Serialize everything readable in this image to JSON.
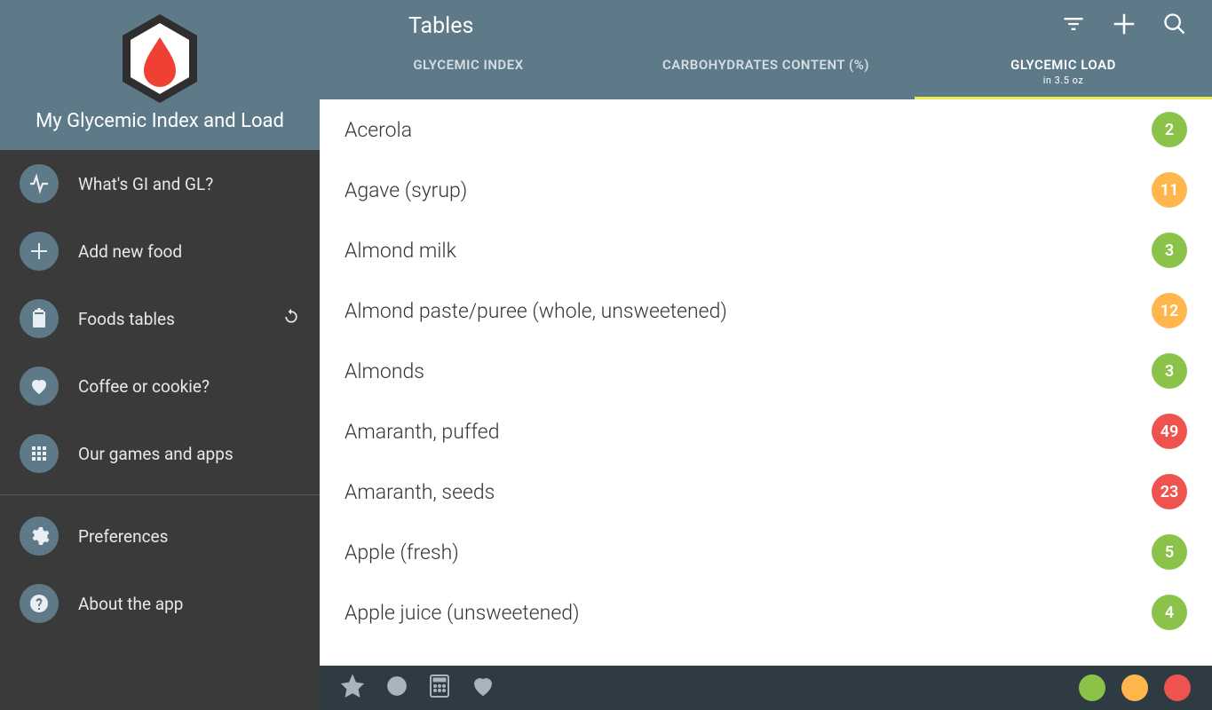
{
  "app": {
    "title": "My Glycemic Index and Load"
  },
  "sidebar": {
    "items": [
      {
        "label": "What's GI and GL?"
      },
      {
        "label": "Add new food"
      },
      {
        "label": "Foods tables"
      },
      {
        "label": "Coffee or cookie?"
      },
      {
        "label": "Our games and apps"
      }
    ],
    "settings": [
      {
        "label": "Preferences"
      },
      {
        "label": "About the app"
      }
    ]
  },
  "header": {
    "title": "Tables",
    "tabs": [
      {
        "label": "GLYCEMIC INDEX",
        "sub": ""
      },
      {
        "label": "CARBOHYDRATES CONTENT (%)",
        "sub": ""
      },
      {
        "label": "GLYCEMIC LOAD",
        "sub": "in 3.5 oz"
      }
    ],
    "active_tab": 2
  },
  "foods": [
    {
      "name": "Acerola",
      "value": "2",
      "color": "green"
    },
    {
      "name": "Agave (syrup)",
      "value": "11",
      "color": "orange"
    },
    {
      "name": "Almond milk",
      "value": "3",
      "color": "green"
    },
    {
      "name": "Almond paste/puree (whole, unsweetened)",
      "value": "12",
      "color": "orange"
    },
    {
      "name": "Almonds",
      "value": "3",
      "color": "green"
    },
    {
      "name": "Amaranth, puffed",
      "value": "49",
      "color": "red"
    },
    {
      "name": "Amaranth, seeds",
      "value": "23",
      "color": "red"
    },
    {
      "name": "Apple (fresh)",
      "value": "5",
      "color": "green"
    },
    {
      "name": "Apple juice (unsweetened)",
      "value": "4",
      "color": "green"
    }
  ]
}
